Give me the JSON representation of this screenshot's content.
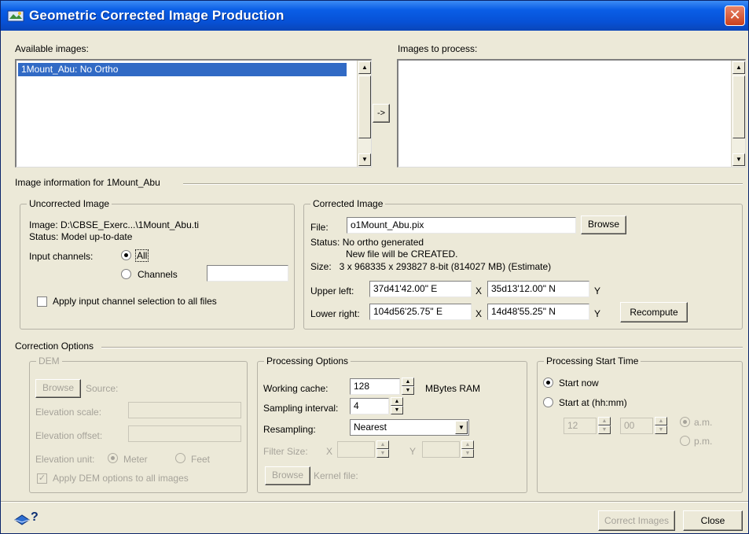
{
  "window": {
    "title": "Geometric Corrected Image Production",
    "close_symbol": "✕"
  },
  "lists": {
    "available_label": "Available images:",
    "available_items": [
      "1Mount_Abu: No Ortho"
    ],
    "move_button": "->",
    "to_process_label": "Images to process:"
  },
  "image_info": {
    "group_label": "Image information for 1Mount_Abu",
    "uncorrected": {
      "legend": "Uncorrected Image",
      "image_line": "Image: D:\\CBSE_Exerc...\\1Mount_Abu.ti",
      "status_line": "Status: Model up-to-date",
      "input_channels_label": "Input channels:",
      "option_all": "All",
      "option_channels": "Channels",
      "channels_value": "",
      "apply_all_label": "Apply input channel selection to all files"
    },
    "corrected": {
      "legend": "Corrected Image",
      "file_label": "File:",
      "file_value": "o1Mount_Abu.pix",
      "browse_label": "Browse",
      "status_line1": "Status: No ortho generated",
      "status_line2": "New file will be CREATED.",
      "size_line": "Size:   3 x 968335 x 293827 8-bit (814027 MB) (Estimate)",
      "upper_left_label": "Upper left:",
      "upper_left_x": "37d41'42.00\" E",
      "upper_left_y": "35d13'12.00\" N",
      "lower_right_label": "Lower right:",
      "lower_right_x": "104d56'25.75\" E",
      "lower_right_y": "14d48'55.25\" N",
      "x_label": "X",
      "y_label": "Y",
      "recompute_label": "Recompute"
    }
  },
  "correction": {
    "group_label": "Correction Options",
    "dem": {
      "legend": "DEM",
      "browse_label": "Browse",
      "source_label": "Source:",
      "source_value": "",
      "elev_scale_label": "Elevation scale:",
      "elev_scale_value": "",
      "elev_offset_label": "Elevation offset:",
      "elev_offset_value": "",
      "elev_unit_label": "Elevation unit:",
      "unit_meter": "Meter",
      "unit_feet": "Feet",
      "apply_all_label": "Apply DEM options to all images"
    },
    "processing": {
      "legend": "Processing Options",
      "cache_label": "Working cache:",
      "cache_value": "128",
      "cache_unit": "MBytes RAM",
      "sampling_label": "Sampling interval:",
      "sampling_value": "4",
      "resampling_label": "Resampling:",
      "resampling_value": "Nearest",
      "filter_label": "Filter Size:",
      "filter_x_label": "X",
      "filter_x_value": "",
      "filter_y_label": "Y",
      "filter_y_value": "",
      "browse_label": "Browse",
      "kernel_label": "Kernel file:"
    },
    "start_time": {
      "legend": "Processing Start Time",
      "start_now_label": "Start now",
      "start_at_label": "Start at (hh:mm)",
      "hours_value": "12",
      "minutes_value": "00",
      "am_label": "a.m.",
      "pm_label": "p.m."
    }
  },
  "footer": {
    "help_label": "?",
    "correct_label": "Correct Images",
    "close_label": "Close"
  },
  "colors": {
    "titlebar": "#0a5ee6",
    "dialog_bg": "#ece9d8",
    "selection": "#316ac5",
    "close_button": "#c9401c"
  }
}
